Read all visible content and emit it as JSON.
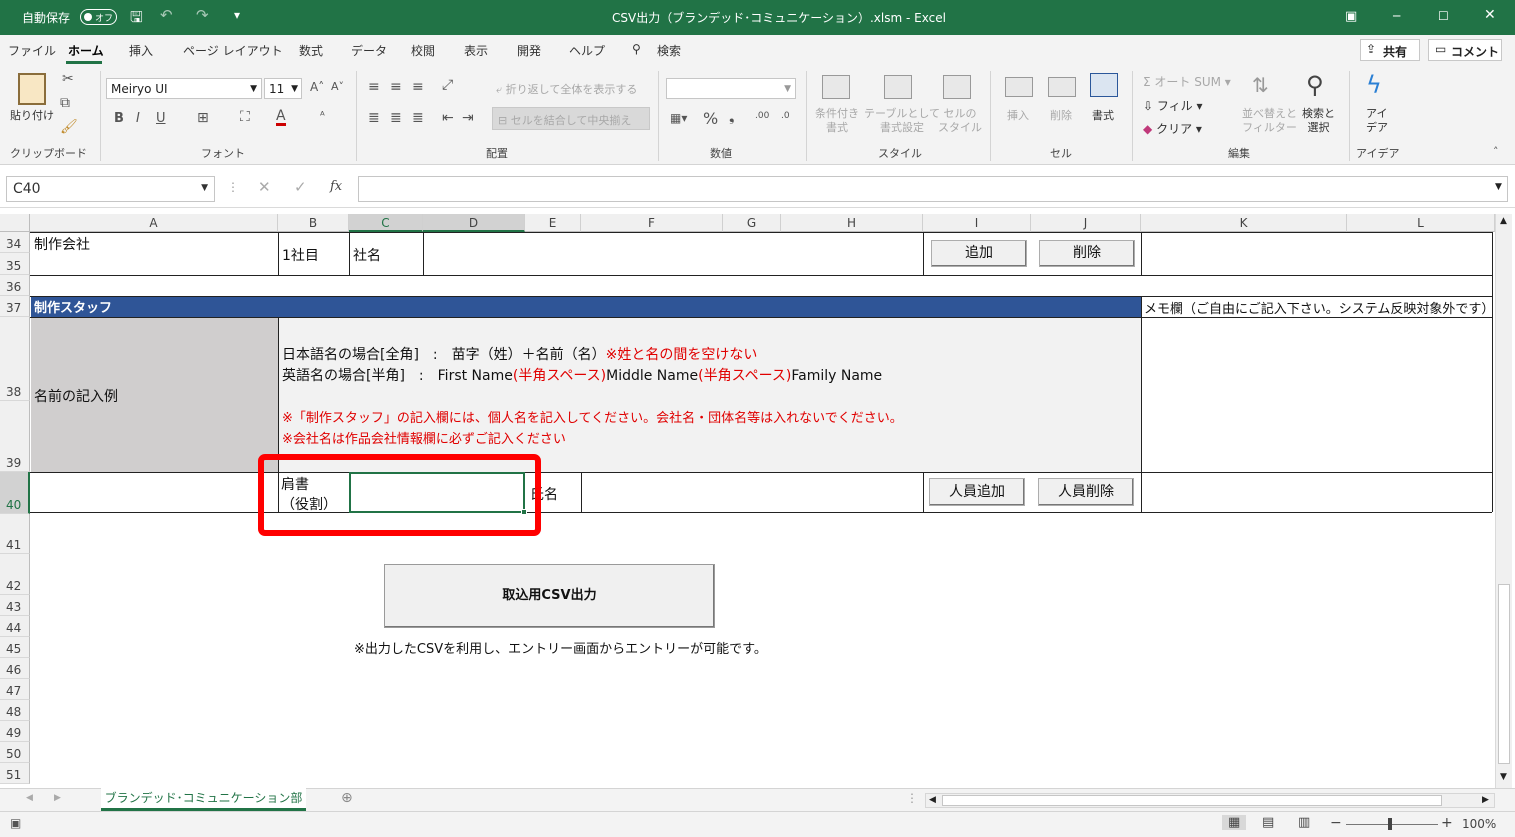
{
  "titlebar": {
    "autosave_label": "自動保存",
    "autosave_state": "オフ",
    "title": "CSV出力（ブランデッド･コミュニケーション）.xlsm  -  Excel"
  },
  "menu": {
    "tabs": [
      "ファイル",
      "ホーム",
      "挿入",
      "ページ レイアウト",
      "数式",
      "データ",
      "校閲",
      "表示",
      "開発",
      "ヘルプ"
    ],
    "search": "検索",
    "share": "共有",
    "comment": "コメント"
  },
  "ribbon": {
    "paste": "貼り付け",
    "clipboard": "クリップボード",
    "font_name": "Meiryo UI",
    "font_size": "11",
    "font_group": "フォント",
    "wrap_text": "折り返して全体を表示する",
    "merge_center": "セルを結合して中央揃え",
    "alignment": "配置",
    "number": "数値",
    "cond_format": "条件付き\n書式",
    "table_format": "テーブルとして\n書式設定",
    "cell_style": "セルの\nスタイル",
    "styles": "スタイル",
    "insert": "挿入",
    "delete": "削除",
    "format": "書式",
    "cells": "セル",
    "autosum": "オート SUM",
    "fill": "フィル",
    "clear": "クリア",
    "sort_filter": "並べ替えと\nフィルター",
    "find_select": "検索と\n選択",
    "editing": "編集",
    "ideas": "アイ\nデア",
    "ideas_group": "アイデア"
  },
  "formula_bar": {
    "name_box": "C40",
    "fx": "fx",
    "content": ""
  },
  "columns": [
    "A",
    "B",
    "C",
    "D",
    "E",
    "F",
    "G",
    "H",
    "I",
    "J",
    "K",
    "L"
  ],
  "rows": [
    "34",
    "35",
    "36",
    "37",
    "38",
    "39",
    "40",
    "41",
    "42",
    "43",
    "44",
    "45",
    "46",
    "47",
    "48",
    "49",
    "50",
    "51"
  ],
  "sheet": {
    "company_label": "制作会社",
    "company_index": "1社目",
    "company_name_label": "社名",
    "add_button": "追加",
    "delete_button": "削除",
    "staff_header": "制作スタッフ",
    "memo_header": "メモ欄（ご自由にご記入下さい。システム反映対象外です）",
    "name_example_label": "名前の記入例",
    "jp_name_rule": "日本語名の場合[全角]　:　苗字（姓）＋名前（名）",
    "jp_name_note": "※姓と名の間を空けない",
    "en_name_prefix": "英語名の場合[半角]　:　First Name",
    "en_space1": "(半角スペース)",
    "en_middle": "Middle Name",
    "en_space2": "(半角スペース)",
    "en_family": "Family Name",
    "note1": "※「制作スタッフ」の記入欄には、個人名を記入してください。会社名・団体名等は入れないでください。",
    "note2": "※会社名は作品会社情報欄に必ずご記入ください",
    "title_label_1": "肩書",
    "title_label_2": "（役割）",
    "name_label": "氏名",
    "add_staff_button": "人員追加",
    "delete_staff_button": "人員削除",
    "csv_button": "取込用CSV出力",
    "csv_note": "※出力したCSVを利用し、エントリー画面からエントリーが可能です。"
  },
  "sheet_tab": "ブランデッド･コミュニケーション部門",
  "zoom": "100%",
  "colors": {
    "excel_green": "#217346",
    "header_blue": "#2f5597",
    "highlight_red": "#ff0000",
    "note_red": "#e00000"
  }
}
